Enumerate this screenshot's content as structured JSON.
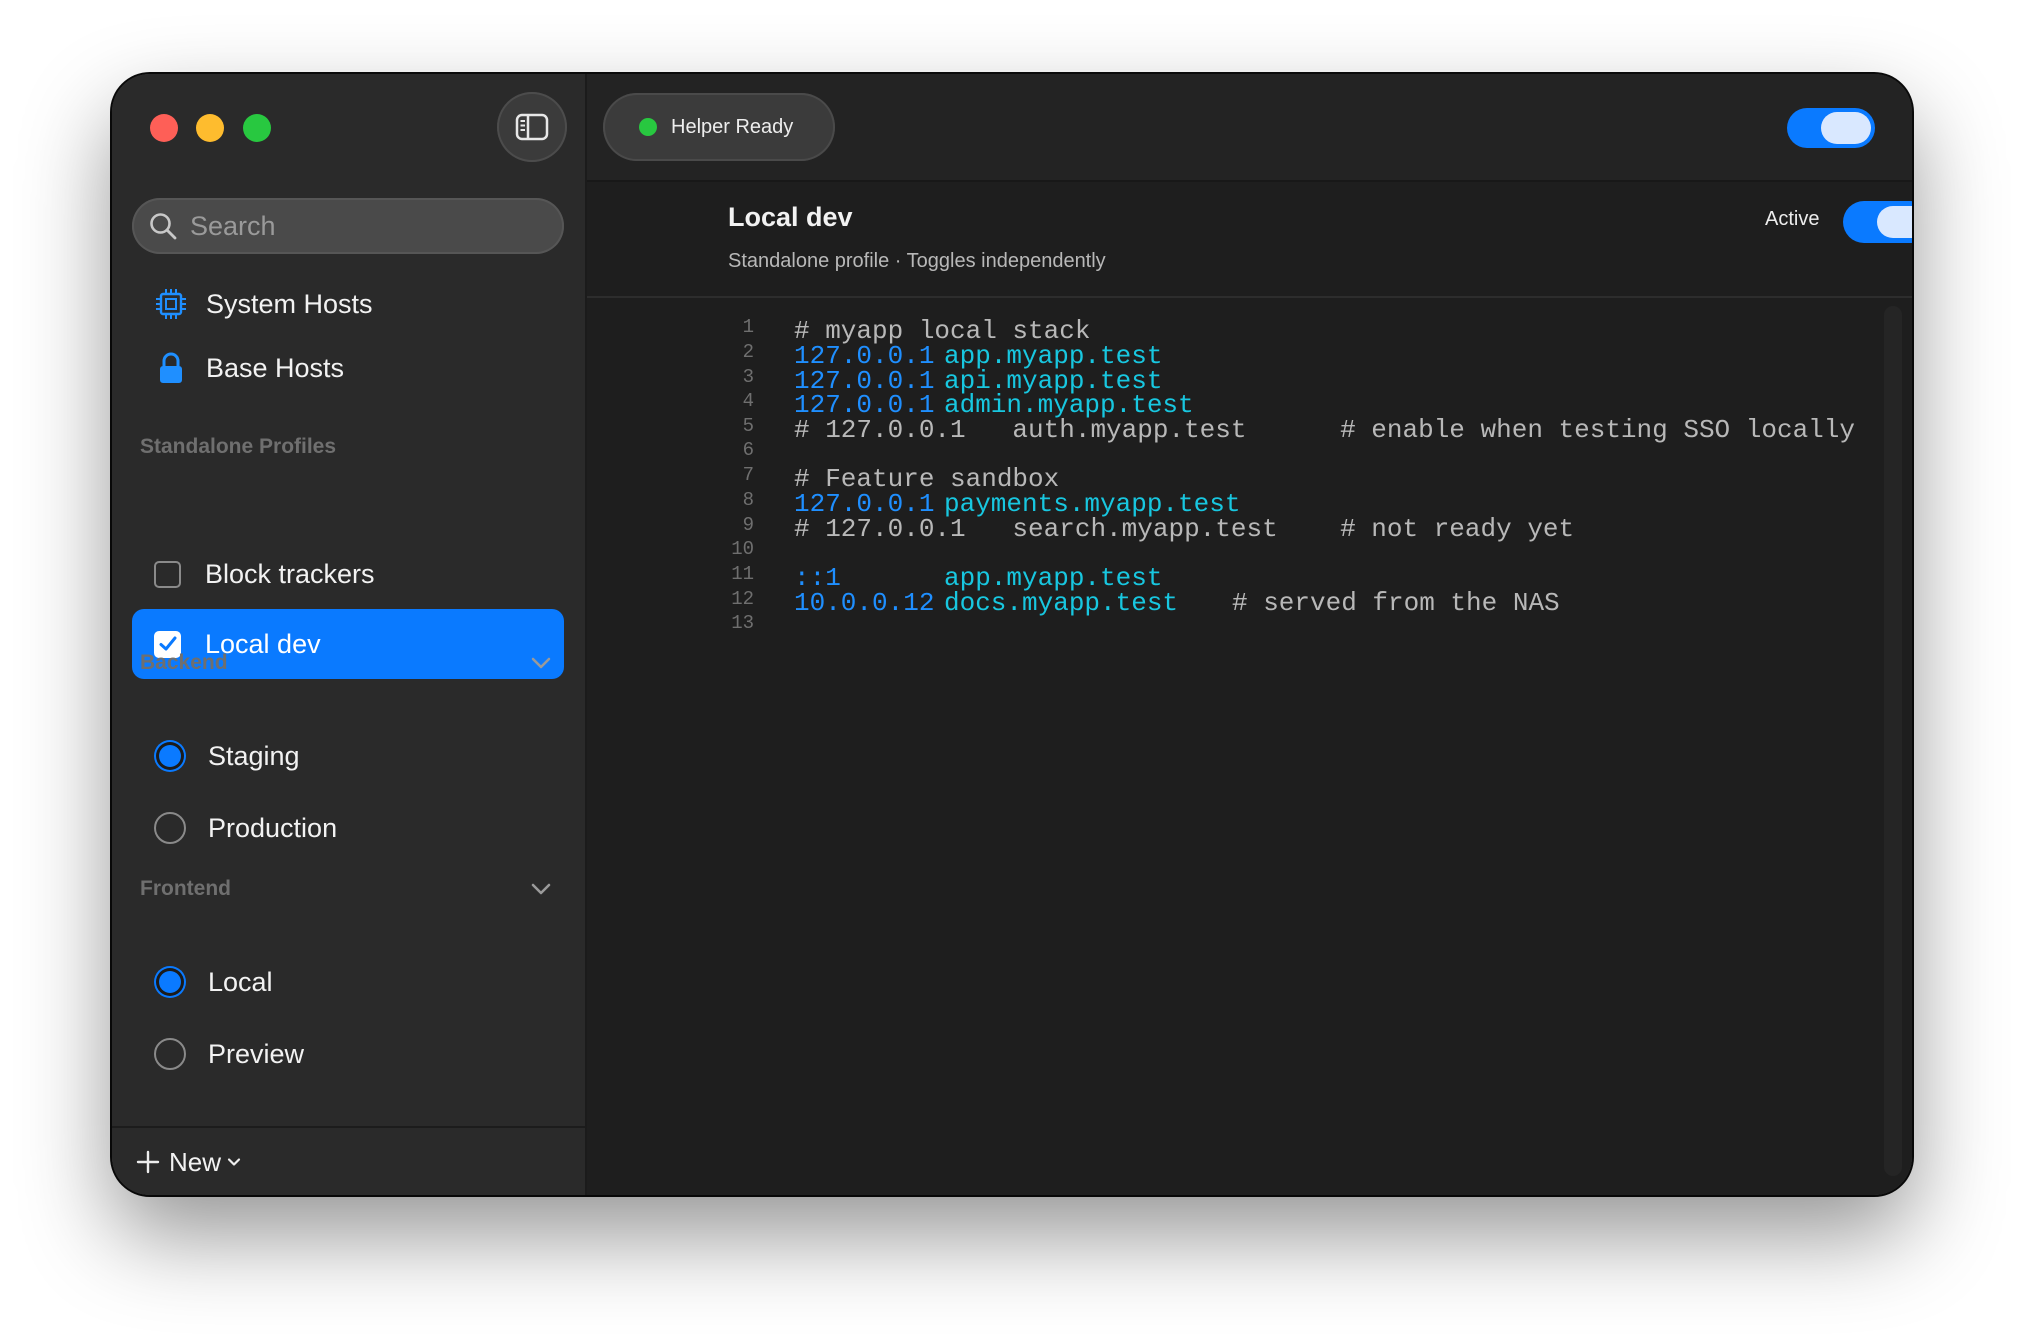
{
  "toolbar": {
    "helper_status": "Helper Ready",
    "helper_status_color": "#28c840"
  },
  "sidebar": {
    "search": {
      "placeholder": "Search",
      "value": ""
    },
    "nav_items": [
      {
        "label": "System Hosts",
        "icon": "cpu-chip-icon"
      },
      {
        "label": "Base Hosts",
        "icon": "lock-icon"
      }
    ],
    "standalone_section": "Standalone Profiles",
    "standalone_profiles": [
      {
        "label": "Block trackers",
        "checked": false,
        "selected": false
      },
      {
        "label": "Local dev",
        "checked": true,
        "selected": true
      }
    ],
    "groups": [
      {
        "label": "Backend",
        "options": [
          {
            "label": "Staging",
            "selected": true
          },
          {
            "label": "Production",
            "selected": false
          }
        ]
      },
      {
        "label": "Frontend",
        "options": [
          {
            "label": "Local",
            "selected": true
          },
          {
            "label": "Preview",
            "selected": false
          }
        ]
      }
    ],
    "new_button": "New"
  },
  "profile": {
    "title": "Local dev",
    "subtitle": "Standalone profile · Toggles independently",
    "active_label": "Active",
    "active": true
  },
  "editor": {
    "lines": [
      {
        "n": "1",
        "text": "# myapp local stack",
        "kind": "comment"
      },
      {
        "n": "2",
        "ip": "127.0.0.1",
        "host": "app.myapp.test",
        "kind": "entry"
      },
      {
        "n": "3",
        "ip": "127.0.0.1",
        "host": "api.myapp.test",
        "kind": "entry"
      },
      {
        "n": "4",
        "ip": "127.0.0.1",
        "host": "admin.myapp.test",
        "kind": "entry"
      },
      {
        "n": "5",
        "text": "# 127.0.0.1   auth.myapp.test      # enable when testing SSO locally",
        "kind": "comment"
      },
      {
        "n": "6",
        "text": "",
        "kind": "blank"
      },
      {
        "n": "7",
        "text": "# Feature sandbox",
        "kind": "comment"
      },
      {
        "n": "8",
        "ip": "127.0.0.1",
        "host": "payments.myapp.test",
        "kind": "entry"
      },
      {
        "n": "9",
        "text": "# 127.0.0.1   search.myapp.test    # not ready yet",
        "kind": "comment"
      },
      {
        "n": "10",
        "text": "",
        "kind": "blank"
      },
      {
        "n": "11",
        "ip": "::1",
        "host": "app.myapp.test",
        "kind": "entry"
      },
      {
        "n": "12",
        "ip": "10.0.0.12",
        "host": "docs.myapp.test",
        "comment": "# served from the NAS",
        "kind": "entry"
      },
      {
        "n": "13",
        "text": "",
        "kind": "blank"
      }
    ]
  },
  "colors": {
    "accent": "#0a7aff",
    "ip": "#1f8fff",
    "host": "#18c7e0",
    "comment": "#b8b8b8"
  }
}
